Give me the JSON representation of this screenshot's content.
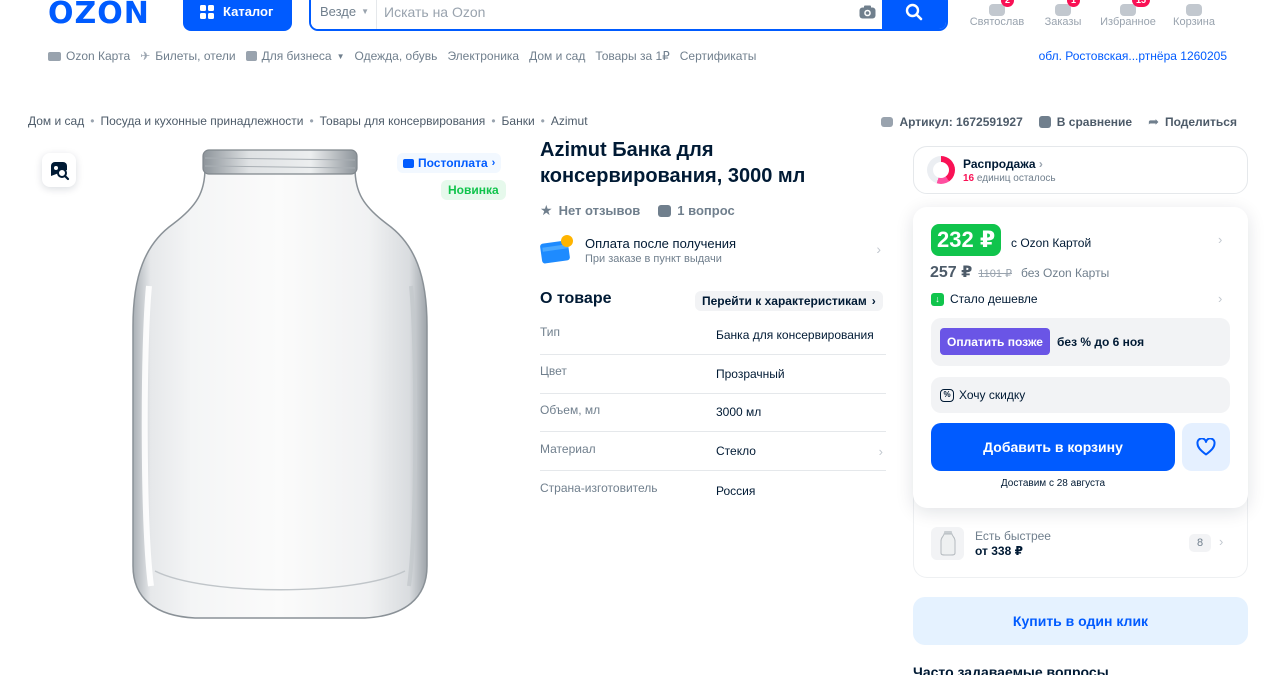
{
  "header": {
    "logo": "OZON",
    "catalog_label": "Каталог",
    "search_scope": "Везде",
    "search_placeholder": "Искать на Ozon",
    "nav": [
      {
        "label": "Святослав",
        "badge": "2"
      },
      {
        "label": "Заказы",
        "badge": "1"
      },
      {
        "label": "Избранное",
        "badge": "15"
      },
      {
        "label": "Корзина",
        "badge": ""
      }
    ]
  },
  "subnav": {
    "items": [
      "Ozon Карта",
      "Билеты, отели",
      "Для бизнеса",
      "Одежда, обувь",
      "Электроника",
      "Дом и сад",
      "Товары за 1₽",
      "Сертификаты"
    ],
    "location": "обл. Ростовская...ртнёра 1260205"
  },
  "breadcrumbs": [
    "Дом и сад",
    "Посуда и кухонные принадлежности",
    "Товары для консервирования",
    "Банки",
    "Azimut"
  ],
  "meta": {
    "article": "Артикул: 1672591927",
    "compare": "В сравнение",
    "share": "Поделиться"
  },
  "image_badges": {
    "postpay": "Постоплата",
    "new": "Новинка"
  },
  "product": {
    "title": "Azimut Банка для консервирования, 3000 мл",
    "reviews": "Нет отзывов",
    "questions": "1 вопрос",
    "pay_after_title": "Оплата после получения",
    "pay_after_sub": "При заказе в пункт выдачи",
    "about_title": "О товаре",
    "goto_specs": "Перейти к характеристикам",
    "specs": [
      {
        "k": "Тип",
        "v": "Банка для консервирования"
      },
      {
        "k": "Цвет",
        "v": "Прозрачный"
      },
      {
        "k": "Объем, мл",
        "v": "3000 мл"
      },
      {
        "k": "Материал",
        "v": "Стекло"
      },
      {
        "k": "Страна-изготовитель",
        "v": "Россия"
      }
    ]
  },
  "buybox": {
    "sale_title": "Распродажа",
    "sale_count": "16",
    "sale_sub": " единиц осталось",
    "price_card": "232 ₽",
    "price_card_label": "с Ozon Картой",
    "price_regular": "257 ₽",
    "price_old": "1101 ₽",
    "price_regular_label": "без Ozon Карты",
    "cheaper": "Стало дешевле",
    "pay_later_btn": "Оплатить позже",
    "pay_later_text": "без % до 6 ноя",
    "want_discount": "Хочу скидку",
    "add_to_cart": "Добавить в корзину",
    "delivery": "Доставим с 28 августа",
    "faster_title": "Есть быстрее",
    "faster_price": "от 338 ₽",
    "faster_count": "8",
    "one_click": "Купить в один клик",
    "faq_title": "Часто задаваемые вопросы"
  },
  "colors": {
    "brand": "#005bff",
    "price_green": "#10c44c",
    "pay_later": "#6a55e6",
    "badge_red": "#f91155"
  }
}
